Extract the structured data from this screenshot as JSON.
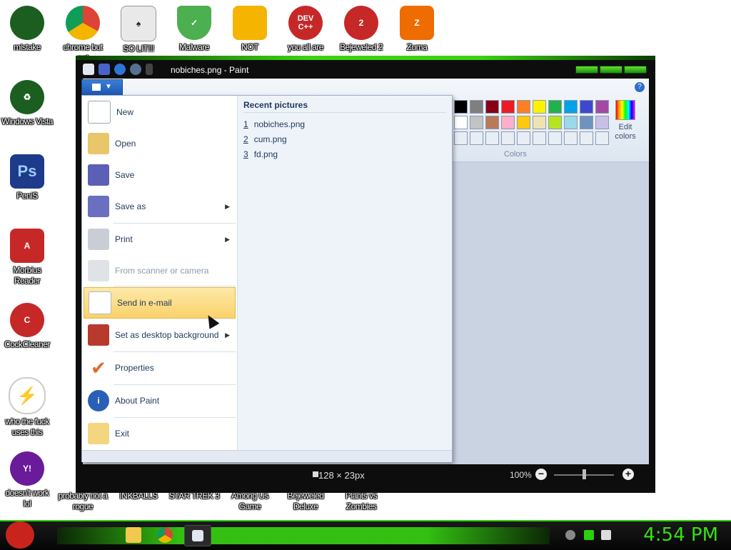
{
  "desktop": {
    "icons": [
      {
        "label": "mistake",
        "color": "#1b5e20"
      },
      {
        "label": "chrome but not",
        "color": "#db4437"
      },
      {
        "label": "SO LIT!!!",
        "color": "#e0e0e0"
      },
      {
        "label": "Malware",
        "color": "#4caf50"
      },
      {
        "label": "NOT",
        "color": "#f4b400"
      },
      {
        "label": "you all are",
        "color": "#c62828"
      },
      {
        "label": "Bejeweled 2",
        "color": "#c62828"
      },
      {
        "label": "Zuma",
        "color": "#ef6c00"
      },
      {
        "label": "Windows Vista",
        "color": "#1b5e20"
      },
      {
        "label": "PeniS",
        "color": "#1e3a8a"
      },
      {
        "label": "Morbius Reader",
        "color": "#c62828"
      },
      {
        "label": "CockCleaner",
        "color": "#c62828"
      },
      {
        "label": "who the fuck uses this",
        "color": "#ef6c00"
      },
      {
        "label": "doesn't work lol",
        "color": "#6a1b9a"
      },
      {
        "label": "probably not a rogue",
        "color": "#1565c0"
      },
      {
        "label": "INKBALLS",
        "color": "#555555"
      },
      {
        "label": "STAR TREK 3",
        "color": "#555555"
      },
      {
        "label": "Among Us Game",
        "color": "#555555"
      },
      {
        "label": "Bejeweled Deluxe",
        "color": "#555555"
      },
      {
        "label": "Plants vs Zombies",
        "color": "#555555"
      }
    ]
  },
  "window": {
    "title": "nobiches.png - Paint",
    "status": {
      "dimensions": "128 × 23px",
      "zoom": "100%"
    }
  },
  "ribbon": {
    "help": "?",
    "colors_label": "Colors",
    "edit_colors_label": "Edit colors",
    "palette": [
      "#000000",
      "#7f7f7f",
      "#880015",
      "#ed1c24",
      "#ff7f27",
      "#fff200",
      "#22b14c",
      "#00a2e8",
      "#3f48cc",
      "#a349a4",
      "#ffffff",
      "#c3c3c3",
      "#b97a57",
      "#ffaec9",
      "#ffc90e",
      "#efe4b0",
      "#b5e61d",
      "#99d9ea",
      "#7092be",
      "#c8bfe7",
      "#e8eef6",
      "#e8eef6",
      "#e8eef6",
      "#e8eef6",
      "#e8eef6",
      "#e8eef6",
      "#e8eef6",
      "#e8eef6",
      "#e8eef6",
      "#e8eef6"
    ]
  },
  "menu": {
    "items": [
      {
        "label": "New",
        "arrow": false
      },
      {
        "label": "Open",
        "arrow": false
      },
      {
        "label": "Save",
        "arrow": false
      },
      {
        "label": "Save as",
        "arrow": true
      },
      {
        "label": "Print",
        "arrow": true
      },
      {
        "label": "From scanner or camera",
        "arrow": false
      },
      {
        "label": "Send in e-mail",
        "arrow": false
      },
      {
        "label": "Set as desktop background",
        "arrow": true
      },
      {
        "label": "Properties",
        "arrow": false
      },
      {
        "label": "About Paint",
        "arrow": false
      },
      {
        "label": "Exit",
        "arrow": false
      }
    ],
    "recent_heading": "Recent pictures",
    "recent": [
      {
        "num": "1",
        "name": "nobiches.png"
      },
      {
        "num": "2",
        "name": "cum.png"
      },
      {
        "num": "3",
        "name": "fd.png"
      }
    ]
  },
  "taskbar": {
    "clock": "4:54 PM"
  }
}
